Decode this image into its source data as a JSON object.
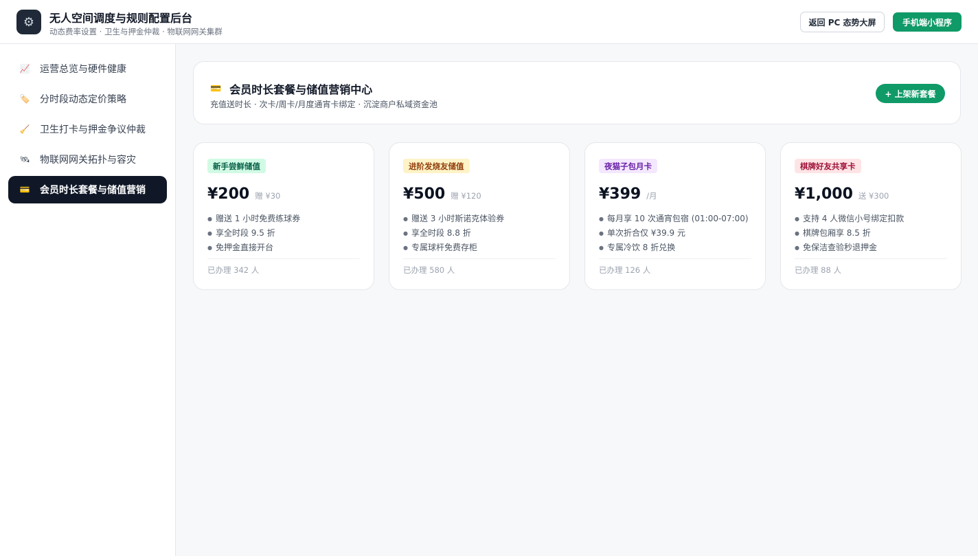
{
  "header": {
    "logo_icon": "gear-icon",
    "title": "无人空间调度与规则配置后台",
    "subtitle": "动态费率设置 · 卫生与押金仲裁 · 物联网网关集群",
    "back_button": "返回 PC 态势大屏",
    "mini_program_button": "手机端小程序"
  },
  "sidebar": {
    "items": [
      {
        "icon": "📈",
        "icon_name": "chart-trend-icon",
        "label": "运营总览与硬件健康",
        "active": false
      },
      {
        "icon": "🏷️",
        "icon_name": "price-tag-icon",
        "label": "分时段动态定价策略",
        "active": false
      },
      {
        "icon": "🧹",
        "icon_name": "broom-icon",
        "label": "卫生打卡与押金争议仲裁",
        "active": false
      },
      {
        "icon": "🛰",
        "icon_name": "satellite-icon",
        "label": "物联网网关拓扑与容灾",
        "active": false
      },
      {
        "icon": "💳",
        "icon_name": "credit-card-icon",
        "label": "会员时长套餐与储值营销",
        "active": true
      }
    ]
  },
  "main": {
    "title_icon": "💳",
    "title": "会员时长套餐与储值营销中心",
    "subtitle": "充值送时长 · 次卡/周卡/月度通宵卡绑定 · 沉淀商户私域资金池",
    "add_button": "+ 上架新套餐",
    "packages": [
      {
        "badge": "新手尝鲜储值",
        "badge_bg": "#d1fae5",
        "badge_color": "#065f46",
        "price": "¥200",
        "bonus": "赠 ¥30",
        "features": [
          "赠送 1 小时免费练球券",
          "享全时段 9.5 折",
          "免押金直接开台"
        ],
        "count": "已办理 342 人"
      },
      {
        "badge": "进阶发烧友储值",
        "badge_bg": "#fef3c7",
        "badge_color": "#92400e",
        "price": "¥500",
        "bonus": "赠 ¥120",
        "features": [
          "赠送 3 小时斯诺克体验券",
          "享全时段 8.8 折",
          "专属球杆免费存柜"
        ],
        "count": "已办理 580 人"
      },
      {
        "badge": "夜猫子包月卡",
        "badge_bg": "#f3e8ff",
        "badge_color": "#6b21a8",
        "price": "¥399",
        "bonus": "/月",
        "features": [
          "每月享 10 次通宵包宿 (01:00-07:00)",
          "单次折合仅 ¥39.9 元",
          "专属冷饮 8 折兑换"
        ],
        "count": "已办理 126 人"
      },
      {
        "badge": "棋牌好友共享卡",
        "badge_bg": "#ffe4e6",
        "badge_color": "#9f1239",
        "price": "¥1,000",
        "bonus": "送 ¥300",
        "features": [
          "支持 4 人微信小号绑定扣款",
          "棋牌包厢享 8.5 折",
          "免保洁查验秒退押金"
        ],
        "count": "已办理 88 人"
      }
    ]
  }
}
